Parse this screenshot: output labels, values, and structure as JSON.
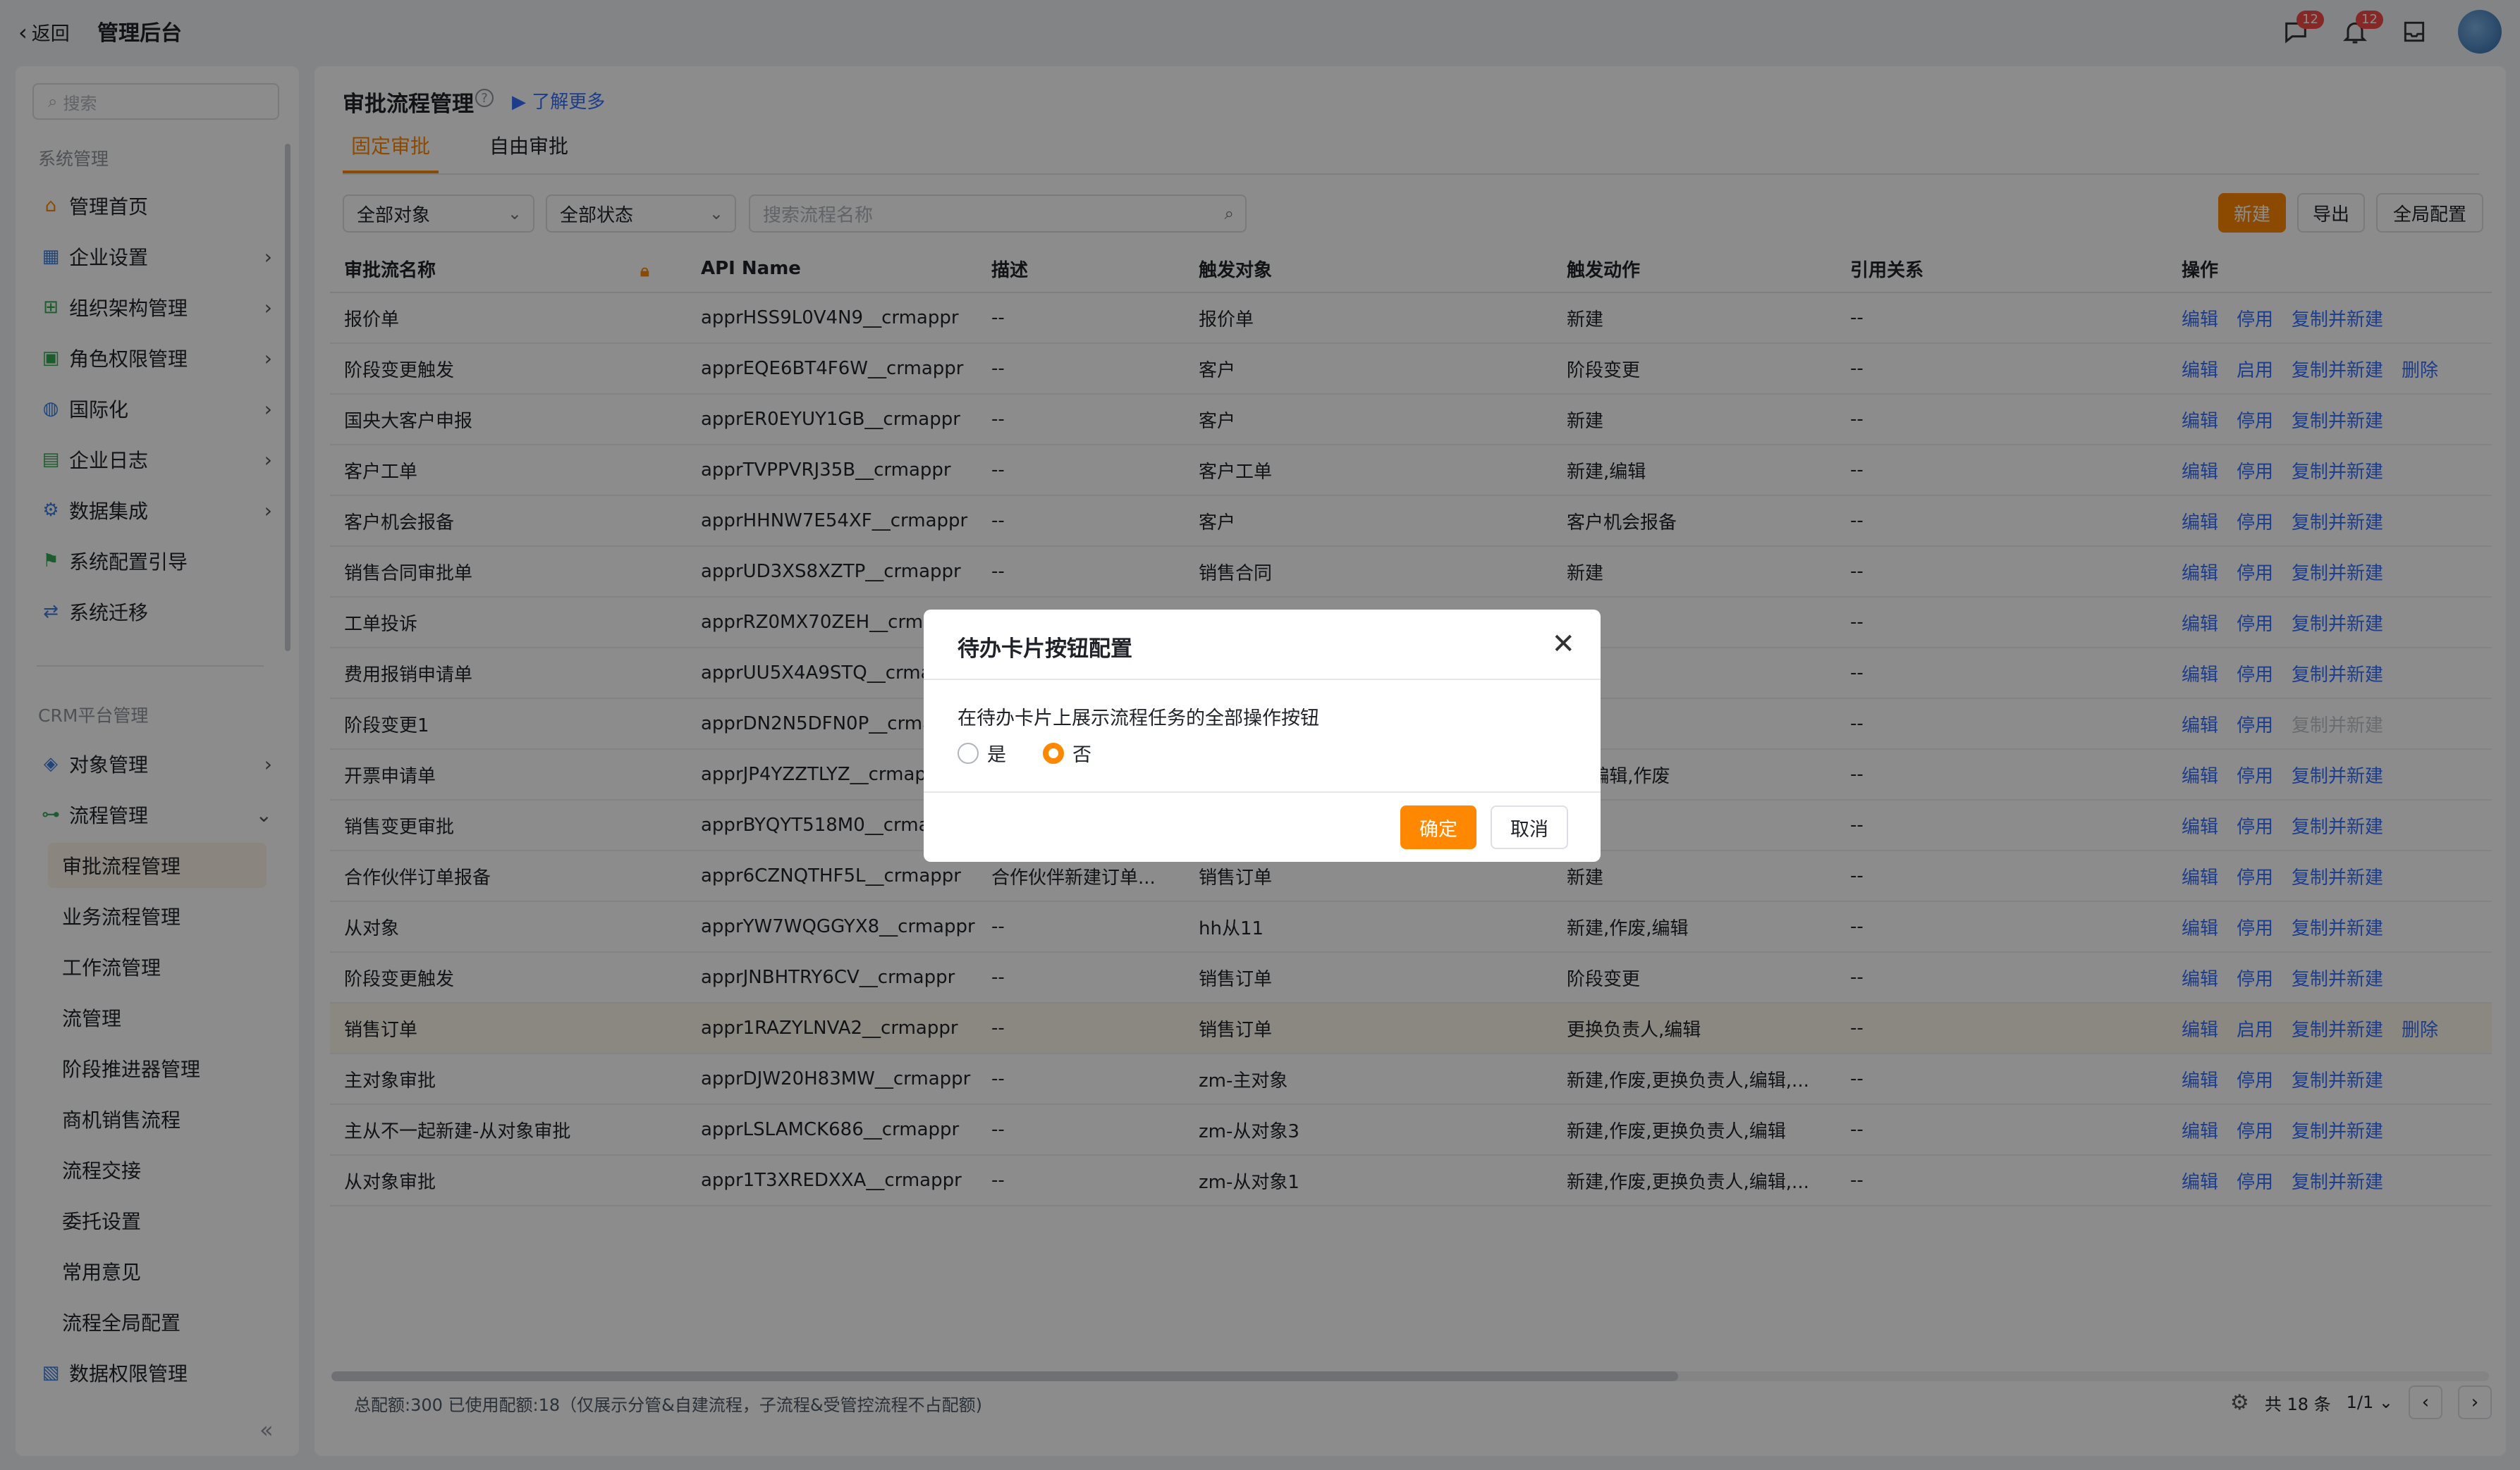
{
  "topbar": {
    "back_label": "返回",
    "app_title": "管理后台",
    "chat_badge": "12",
    "bell_badge": "12"
  },
  "sidebar": {
    "search_placeholder": "搜索",
    "group1": "系统管理",
    "items1": [
      {
        "label": "管理首页",
        "icon": "home-icon",
        "arrow": false
      },
      {
        "label": "企业设置",
        "icon": "building-icon",
        "arrow": true
      },
      {
        "label": "组织架构管理",
        "icon": "org-chart-icon",
        "arrow": true
      },
      {
        "label": "角色权限管理",
        "icon": "role-icon",
        "arrow": true
      },
      {
        "label": "国际化",
        "icon": "globe-icon",
        "arrow": true
      },
      {
        "label": "企业日志",
        "icon": "log-icon",
        "arrow": true
      },
      {
        "label": "数据集成",
        "icon": "data-icon",
        "arrow": true
      },
      {
        "label": "系统配置引导",
        "icon": "guide-icon",
        "arrow": false
      },
      {
        "label": "系统迁移",
        "icon": "migrate-icon",
        "arrow": false
      }
    ],
    "group2": "CRM平台管理",
    "items2": [
      {
        "label": "对象管理",
        "icon": "object-icon",
        "arrow": true
      },
      {
        "label": "流程管理",
        "icon": "flow-icon",
        "arrow": true
      }
    ],
    "sub_items": [
      "审批流程管理",
      "业务流程管理",
      "工作流管理",
      "流管理",
      "阶段推进器管理",
      "商机销售流程",
      "流程交接",
      "委托设置",
      "常用意见",
      "流程全局配置"
    ],
    "last_item": "数据权限管理"
  },
  "main": {
    "title": "审批流程管理",
    "learn_more": "了解更多",
    "tabs": [
      "固定审批",
      "自由审批"
    ],
    "filter_object": "全部对象",
    "filter_status": "全部状态",
    "search_placeholder": "搜索流程名称",
    "btn_new": "新建",
    "btn_export": "导出",
    "btn_global": "全局配置"
  },
  "table": {
    "headers": [
      "审批流名称",
      "API Name",
      "描述",
      "触发对象",
      "触发动作",
      "引用关系",
      "操作"
    ],
    "rows": [
      {
        "name": "报价单",
        "api": "apprHSS9L0V4N9__crmappr",
        "desc": "--",
        "obj": "报价单",
        "action": "新建",
        "ref": "--",
        "ops": [
          "编辑",
          "停用",
          "复制并新建"
        ]
      },
      {
        "name": "阶段变更触发",
        "api": "apprEQE6BT4F6W__crmappr",
        "desc": "--",
        "obj": "客户",
        "action": "阶段变更",
        "ref": "--",
        "ops": [
          "编辑",
          "启用",
          "复制并新建",
          "删除"
        ]
      },
      {
        "name": "国央大客户申报",
        "api": "apprER0EYUY1GB__crmappr",
        "desc": "--",
        "obj": "客户",
        "action": "新建",
        "ref": "--",
        "ops": [
          "编辑",
          "停用",
          "复制并新建"
        ]
      },
      {
        "name": "客户工单",
        "api": "apprTVPPVRJ35B__crmappr",
        "desc": "--",
        "obj": "客户工单",
        "action": "新建,编辑",
        "ref": "--",
        "ops": [
          "编辑",
          "停用",
          "复制并新建"
        ]
      },
      {
        "name": "客户机会报备",
        "api": "apprHHNW7E54XF__crmappr",
        "desc": "--",
        "obj": "客户",
        "action": "客户机会报备",
        "ref": "--",
        "ops": [
          "编辑",
          "停用",
          "复制并新建"
        ]
      },
      {
        "name": "销售合同审批单",
        "api": "apprUD3XS8XZTP__crmappr",
        "desc": "--",
        "obj": "销售合同",
        "action": "新建",
        "ref": "--",
        "ops": [
          "编辑",
          "停用",
          "复制并新建"
        ]
      },
      {
        "name": "工单投诉",
        "api": "apprRZ0MX70ZEH__crmappr",
        "desc": "--",
        "obj": "",
        "action": "建",
        "ref": "--",
        "ops": [
          "编辑",
          "停用",
          "复制并新建"
        ]
      },
      {
        "name": "费用报销申请单",
        "api": "apprUU5X4A9STQ__crmappr",
        "desc": "--",
        "obj": "",
        "action": "建",
        "ref": "--",
        "ops": [
          "编辑",
          "停用",
          "复制并新建"
        ]
      },
      {
        "name": "阶段变更1",
        "api": "apprDN2N5DFN0P__crmappr",
        "desc": "--",
        "obj": "",
        "action": "",
        "ref": "--",
        "ops": [
          "编辑",
          "停用",
          "复制并新建"
        ],
        "disabled_last": true
      },
      {
        "name": "开票申请单",
        "api": "apprJP4YZZTLYZ__crmappr",
        "desc": "--",
        "obj": "",
        "action": "建,编辑,作废",
        "ref": "--",
        "ops": [
          "编辑",
          "停用",
          "复制并新建"
        ]
      },
      {
        "name": "销售变更审批",
        "api": "apprBYQYT518M0__crmappr",
        "desc": "--",
        "obj": "",
        "action": "建",
        "ref": "--",
        "ops": [
          "编辑",
          "停用",
          "复制并新建"
        ]
      },
      {
        "name": "合作伙伴订单报备",
        "api": "appr6CZNQTHF5L__crmappr",
        "desc": "合作伙伴新建订单...",
        "obj": "销售订单",
        "action": "新建",
        "ref": "--",
        "ops": [
          "编辑",
          "停用",
          "复制并新建"
        ]
      },
      {
        "name": "从对象",
        "api": "apprYW7WQGGYX8__crmappr",
        "desc": "--",
        "obj": "hh从11",
        "action": "新建,作废,编辑",
        "ref": "--",
        "ops": [
          "编辑",
          "停用",
          "复制并新建"
        ]
      },
      {
        "name": "阶段变更触发",
        "api": "apprJNBHTRY6CV__crmappr",
        "desc": "--",
        "obj": "销售订单",
        "action": "阶段变更",
        "ref": "--",
        "ops": [
          "编辑",
          "停用",
          "复制并新建"
        ]
      },
      {
        "name": "销售订单",
        "api": "appr1RAZYLNVA2__crmappr",
        "desc": "--",
        "obj": "销售订单",
        "action": "更换负责人,编辑",
        "ref": "--",
        "ops": [
          "编辑",
          "启用",
          "复制并新建",
          "删除"
        ],
        "highlight": true
      },
      {
        "name": "主对象审批",
        "api": "apprDJW20H83MW__crmappr",
        "desc": "--",
        "obj": "zm-主对象",
        "action": "新建,作废,更换负责人,编辑,...",
        "ref": "--",
        "ops": [
          "编辑",
          "停用",
          "复制并新建"
        ]
      },
      {
        "name": "主从不一起新建-从对象审批",
        "api": "apprLSLAMCK686__crmappr",
        "desc": "--",
        "obj": "zm-从对象3",
        "action": "新建,作废,更换负责人,编辑",
        "ref": "--",
        "ops": [
          "编辑",
          "停用",
          "复制并新建"
        ]
      },
      {
        "name": "从对象审批",
        "api": "appr1T3XREDXXA__crmappr",
        "desc": "--",
        "obj": "zm-从对象1",
        "action": "新建,作废,更换负责人,编辑,...",
        "ref": "--",
        "ops": [
          "编辑",
          "停用",
          "复制并新建"
        ]
      }
    ]
  },
  "footer": {
    "note": "总配额:300 已使用配额:18（仅展示分管&自建流程，子流程&受管控流程不占配额)",
    "total": "共 18 条",
    "page": "1/1"
  },
  "modal": {
    "title": "待办卡片按钮配置",
    "desc": "在待办卡片上展示流程任务的全部操作按钮",
    "opt_yes": "是",
    "opt_no": "否",
    "selected": "否",
    "ok": "确定",
    "cancel": "取消"
  },
  "colors": {
    "accent": "#ff8800",
    "link": "#3370ff",
    "badge": "#f54a45"
  }
}
